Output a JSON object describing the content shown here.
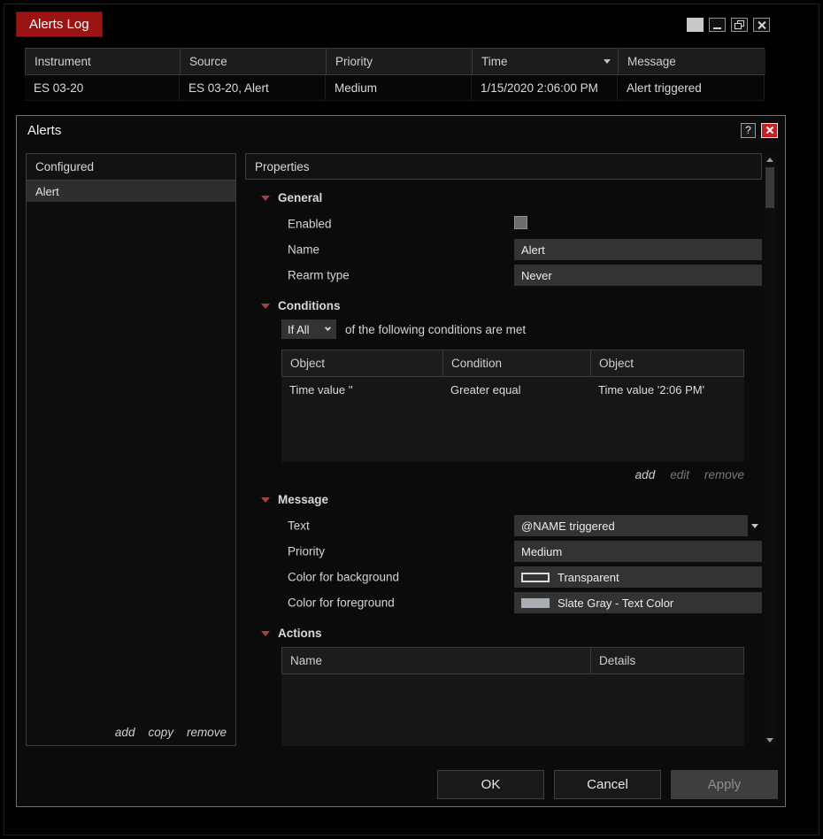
{
  "colors": {
    "accent_red": "#9b1414",
    "close_red": "#c42222",
    "expander": "#a34343",
    "swatch_gray": "#a9aeb4"
  },
  "alerts_log": {
    "title": "Alerts Log",
    "table": {
      "columns": [
        "Instrument",
        "Source",
        "Priority",
        "Time",
        "Message"
      ],
      "rows": [
        [
          "ES 03-20",
          "ES 03-20, Alert",
          "Medium",
          "1/15/2020 2:06:00 PM",
          "Alert triggered"
        ]
      ]
    }
  },
  "dialog": {
    "title": "Alerts",
    "help_label": "?",
    "configured": {
      "header": "Configured",
      "items": [
        "Alert"
      ],
      "links": [
        "add",
        "copy",
        "remove"
      ]
    },
    "properties": {
      "header": "Properties",
      "sections": {
        "general": {
          "title": "General",
          "enabled_label": "Enabled",
          "name_label": "Name",
          "name_value": "Alert",
          "rearm_label": "Rearm type",
          "rearm_value": "Never"
        },
        "conditions": {
          "title": "Conditions",
          "match_value": "If All",
          "match_text": "of the following conditions are met",
          "columns": [
            "Object",
            "Condition",
            "Object"
          ],
          "rows": [
            [
              "Time value ''",
              "Greater equal",
              "Time value '2:06 PM'"
            ]
          ],
          "links": {
            "add": "add",
            "edit": "edit",
            "remove": "remove"
          }
        },
        "message": {
          "title": "Message",
          "text_label": "Text",
          "text_value": "@NAME triggered",
          "priority_label": "Priority",
          "priority_value": "Medium",
          "background_label": "Color for background",
          "background_value": "Transparent",
          "foreground_label": "Color for foreground",
          "foreground_value": "Slate Gray - Text Color"
        },
        "actions": {
          "title": "Actions",
          "columns": [
            "Name",
            "Details"
          ]
        }
      }
    },
    "buttons": {
      "ok": "OK",
      "cancel": "Cancel",
      "apply": "Apply"
    }
  }
}
